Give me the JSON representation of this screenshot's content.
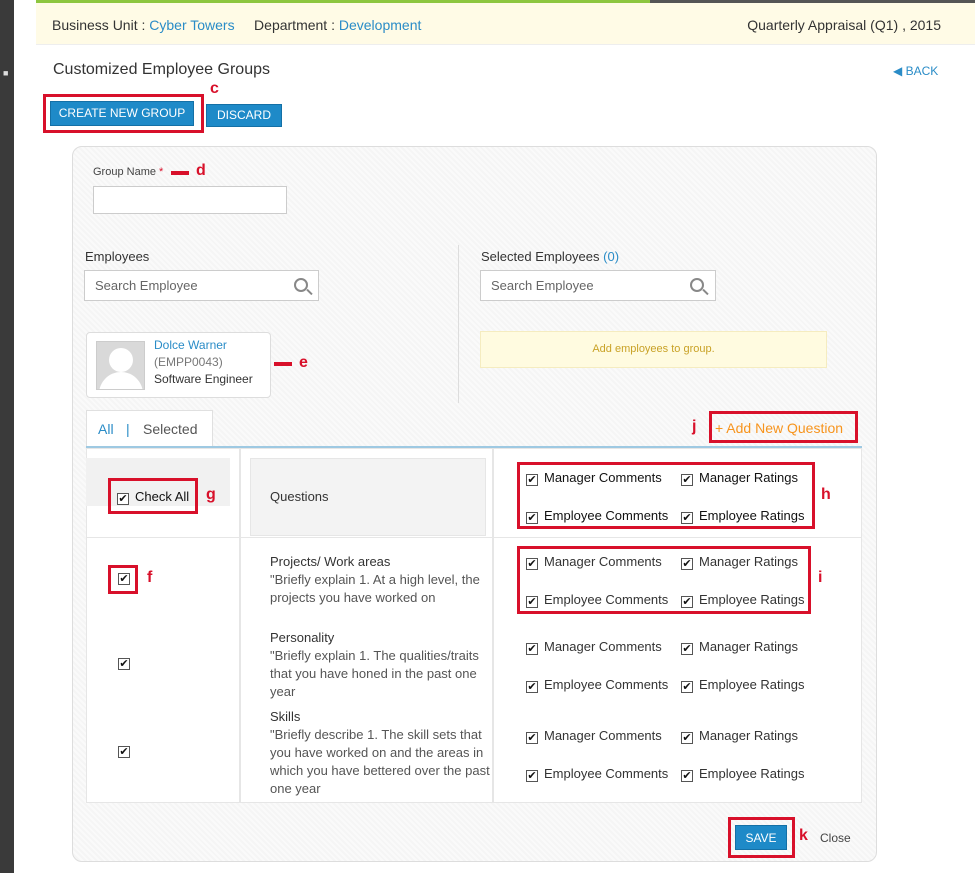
{
  "header": {
    "business_unit_label": "Business Unit :",
    "business_unit_value": "Cyber Towers",
    "department_label": "Department :",
    "department_value": "Development",
    "appraisal": "Quarterly Appraisal (Q1) , 2015"
  },
  "page": {
    "title": "Customized Employee Groups",
    "back_label": "BACK"
  },
  "toolbar": {
    "create_label": "CREATE NEW GROUP",
    "discard_label": "DISCARD"
  },
  "form": {
    "group_name_label": "Group Name",
    "required_mark": "*",
    "group_name_value": "",
    "employees_label": "Employees",
    "selected_employees_label": "Selected Employees",
    "selected_count": "(0)",
    "search_placeholder": "Search Employee",
    "add_employees_note": "Add employees to group."
  },
  "employee": {
    "name": "Dolce Warner",
    "id": "(EMPP0043)",
    "role": "Software Engineer"
  },
  "tabs": {
    "all": "All",
    "separator": "|",
    "selected": "Selected"
  },
  "add_question_label": "+ Add New Question",
  "table": {
    "check_all_label": "Check All",
    "questions_header": "Questions",
    "options": [
      "Manager Comments",
      "Manager Ratings",
      "Employee Comments",
      "Employee Ratings"
    ],
    "questions": [
      {
        "title": "Projects/ Work areas",
        "description": "\"Briefly explain 1. At a high level, the projects you have worked on"
      },
      {
        "title": "Personality",
        "description": "\"Briefly explain 1. The qualities/traits that you have honed in the past one year"
      },
      {
        "title": "Skills",
        "description": "\"Briefly describe 1. The skill sets that you have worked on and the areas in which you have bettered over the past one year"
      }
    ]
  },
  "footer": {
    "save_label": "SAVE",
    "close_label": "Close"
  },
  "annotations": [
    "c",
    "d",
    "e",
    "f",
    "g",
    "h",
    "i",
    "j",
    "k"
  ],
  "checkmark": "✔",
  "colors": {
    "accent": "#1e8ac8",
    "link": "#2a8cc7",
    "annotation": "#d8102a",
    "add_question": "#f7941d"
  }
}
